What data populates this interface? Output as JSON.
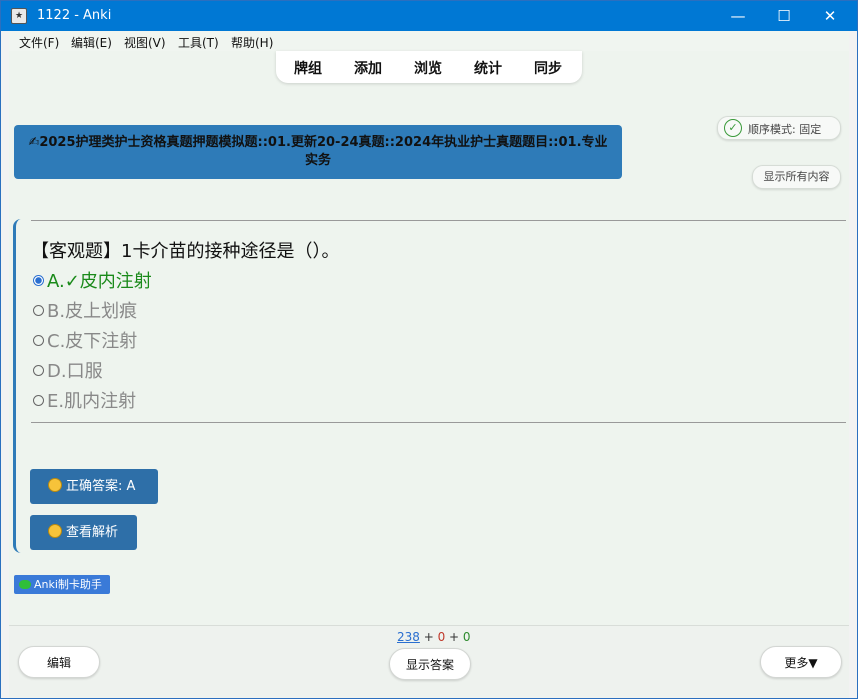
{
  "window": {
    "title": "1122 - Anki",
    "controls": {
      "minimize": "—",
      "maximize": "☐",
      "close": "✕"
    }
  },
  "menu": {
    "items": [
      "文件(F)",
      "编辑(E)",
      "视图(V)",
      "工具(T)",
      "帮助(H)"
    ]
  },
  "toolbar": {
    "items": [
      "牌组",
      "添加",
      "浏览",
      "统计",
      "同步"
    ]
  },
  "deck": {
    "path": "✍2025护理类护士资格真题押题模拟题::01.更新20-24真题::2024年执业护士真题题目::01.专业实务"
  },
  "mode": {
    "label": "顺序模式: 固定",
    "check": "✓"
  },
  "show_all_label": "显示所有内容",
  "question": {
    "text": "【客观题】1卡介苗的接种途径是（）。",
    "options": [
      {
        "text": "A.✓皮内注射",
        "correct": true
      },
      {
        "text": "B.皮上划痕",
        "correct": false
      },
      {
        "text": "C.皮下注射",
        "correct": false
      },
      {
        "text": "D.口服",
        "correct": false
      },
      {
        "text": "E.肌内注射",
        "correct": false
      }
    ]
  },
  "answer_button": {
    "label": "正确答案: A"
  },
  "analysis_button": {
    "label": "查看解析"
  },
  "helper_badge": {
    "label": "Anki制卡助手"
  },
  "counts": {
    "new": "238",
    "sep1": " + ",
    "learn": "0",
    "sep2": " + ",
    "review": "0"
  },
  "bottom": {
    "edit_label": "编辑",
    "show_answer_label": "显示答案",
    "more_label": "更多▼"
  },
  "colors": {
    "titlebar": "#0078d4",
    "accent_blue": "#2e7bb8",
    "correct_green": "#1a8a1a",
    "helper_blue": "#3a7ad8"
  }
}
